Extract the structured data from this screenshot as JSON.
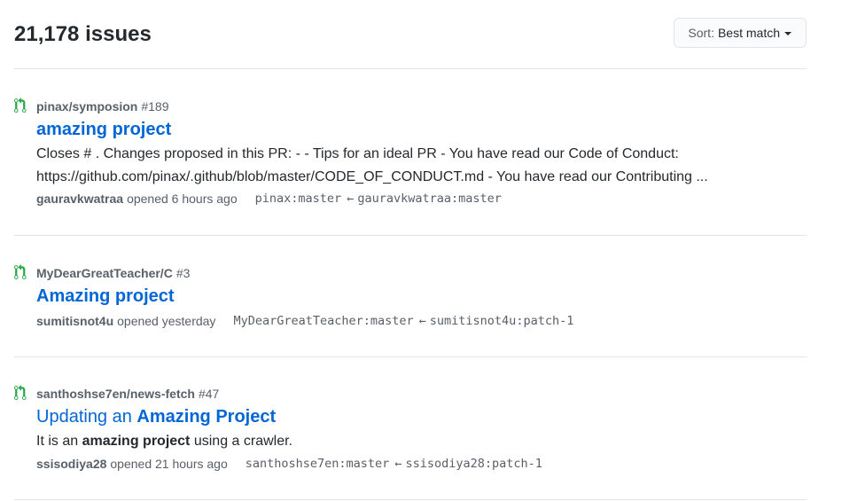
{
  "header": {
    "count_title": "21,178 issues",
    "sort_prefix": "Sort:",
    "sort_value": "Best match"
  },
  "icons": {
    "pr": "git-pull-request-icon",
    "caret": "caret-down-icon"
  },
  "colors": {
    "pr_open": "#28a745",
    "link": "#0366d6",
    "muted": "#586069"
  },
  "issues": [
    {
      "repo": "pinax/symposion",
      "number": "#189",
      "title": "amazing project",
      "body": "Closes # . Changes proposed in this PR: - - Tips for an ideal PR - You have read our Code of Conduct: https://github.com/pinax/.github/blob/master/CODE_OF_CONDUCT.md - You have read our Contributing ...",
      "author": "gauravkwatraa",
      "opened": "opened 6 hours ago",
      "base_branch": "pinax:master",
      "arrow": "←",
      "head_branch": "gauravkwatraa:master"
    },
    {
      "repo": "MyDearGreatTeacher/C",
      "number": "#3",
      "title": "Amazing project",
      "author": "sumitisnot4u",
      "opened": "opened yesterday",
      "base_branch": "MyDearGreatTeacher:master",
      "arrow": "←",
      "head_branch": "sumitisnot4u:patch-1"
    },
    {
      "repo": "santhoshse7en/news-fetch",
      "number": "#47",
      "title_prefix": "Updating an ",
      "title_highlight": "Amazing Project",
      "body_prefix": "It is an ",
      "body_highlight": "amazing project",
      "body_suffix": " using a crawler.",
      "author": "ssisodiya28",
      "opened": "opened 21 hours ago",
      "base_branch": "santhoshse7en:master",
      "arrow": "←",
      "head_branch": "ssisodiya28:patch-1"
    }
  ]
}
